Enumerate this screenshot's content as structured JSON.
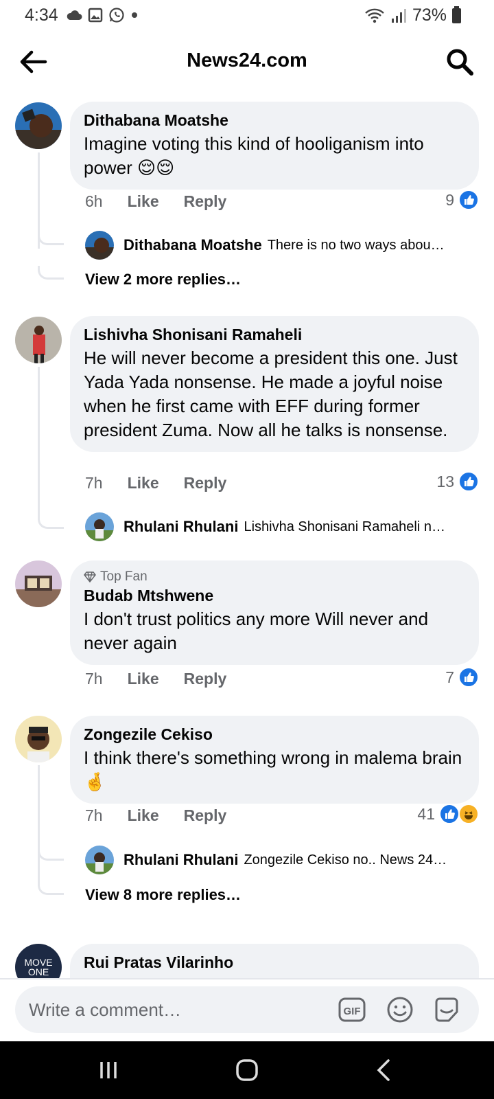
{
  "status_bar": {
    "time": "4:34",
    "battery": "73%"
  },
  "header": {
    "title": "News24.com"
  },
  "comments": [
    {
      "author": "Dithabana Moatshe",
      "text": "Imagine voting this kind of hooliganism into power 😌😌",
      "time": "6h",
      "like_label": "Like",
      "reply_label": "Reply",
      "reactions": "9",
      "reply_preview": {
        "author": "Dithabana Moatshe",
        "text": "There is no two ways abou…"
      },
      "more_replies": "View 2 more replies…"
    },
    {
      "author": "Lishivha Shonisani Ramaheli",
      "text": "He will never become a president this one. Just Yada Yada nonsense. He made a joyful noise when he first came with EFF during former president Zuma. Now all he talks is nonsense.",
      "time": "7h",
      "like_label": "Like",
      "reply_label": "Reply",
      "reactions": "13",
      "reply_preview": {
        "author": "Rhulani Rhulani",
        "text": "Lishivha Shonisani Ramaheli n…"
      }
    },
    {
      "badge": "Top Fan",
      "author": "Budab Mtshwene",
      "text": "I don't trust politics any more Will never and never again",
      "time": "7h",
      "like_label": "Like",
      "reply_label": "Reply",
      "reactions": "7"
    },
    {
      "author": "Zongezile Cekiso",
      "text": "I think there's something wrong in malema brain 🤞",
      "time": "7h",
      "like_label": "Like",
      "reply_label": "Reply",
      "reactions": "41",
      "reply_preview": {
        "author": "Rhulani Rhulani",
        "text": "Zongezile Cekiso no.. News 24…"
      },
      "more_replies": "View 8 more replies…"
    },
    {
      "author": "Rui Pratas Vilarinho",
      "avatar_text": "MOVE ONE"
    }
  ],
  "composer": {
    "placeholder": "Write a comment…",
    "gif_label": "GIF"
  },
  "icons": [
    "back-arrow-icon",
    "search-icon",
    "cloud-icon",
    "gallery-icon",
    "whatsapp-icon",
    "wifi-icon",
    "signal-icon",
    "battery-icon",
    "diamond-icon",
    "like-icon",
    "haha-icon",
    "gif-icon",
    "emoji-icon",
    "sticker-icon",
    "recent-apps-icon",
    "home-icon",
    "back-nav-icon"
  ],
  "colors": {
    "like_blue": "#1b74e4",
    "bubble_gray": "#f0f2f5",
    "meta_gray": "#65676b"
  }
}
